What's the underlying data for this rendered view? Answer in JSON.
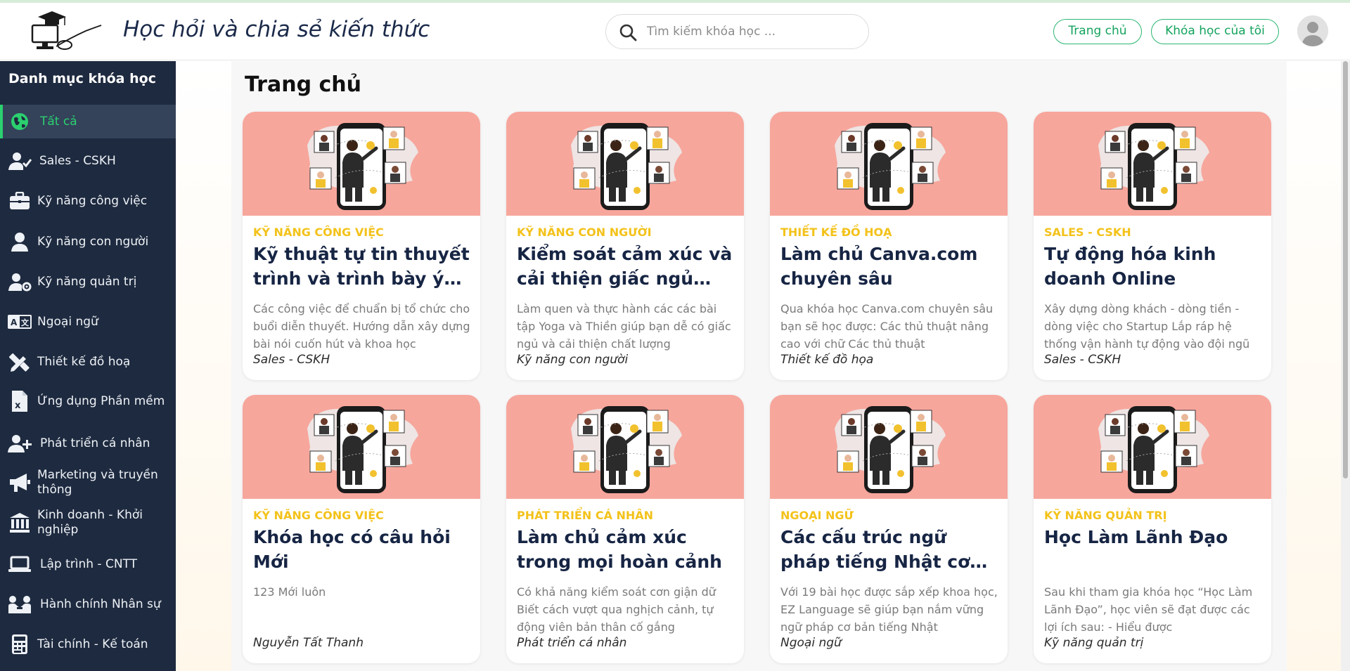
{
  "header": {
    "site_title": "Học hỏi và chia sẻ kiến thức",
    "search_placeholder": "Tìm kiếm khóa học ...",
    "nav_home": "Trang chủ",
    "nav_my_courses": "Khóa học của tôi"
  },
  "sidebar": {
    "title": "Danh mục khóa học",
    "items": [
      {
        "label": "Tất cả",
        "icon": "globe-icon",
        "active": true
      },
      {
        "label": "Sales - CSKH",
        "icon": "user-check-icon"
      },
      {
        "label": "Kỹ năng công việc",
        "icon": "briefcase-icon"
      },
      {
        "label": "Kỹ năng con người",
        "icon": "user-icon"
      },
      {
        "label": "Kỹ năng quản trị",
        "icon": "user-gear-icon"
      },
      {
        "label": "Ngoại ngữ",
        "icon": "language-icon"
      },
      {
        "label": "Thiết kế đồ hoạ",
        "icon": "design-tools-icon"
      },
      {
        "label": "Ứng dụng Phần mềm",
        "icon": "excel-file-icon"
      },
      {
        "label": "Phát triển cá nhân",
        "icon": "user-plus-icon"
      },
      {
        "label": "Marketing và truyền thông",
        "icon": "megaphone-icon"
      },
      {
        "label": "Kinh doanh - Khởi nghiệp",
        "icon": "bank-icon"
      },
      {
        "label": "Lập trình - CNTT",
        "icon": "laptop-icon"
      },
      {
        "label": "Hành chính Nhân sự",
        "icon": "people-icon"
      },
      {
        "label": "Tài chính - Kế toán",
        "icon": "calculator-icon"
      }
    ]
  },
  "main": {
    "page_title": "Trang chủ",
    "courses": [
      {
        "category": "KỸ NĂNG CÔNG VIỆC",
        "title": "Kỹ thuật tự tin thuyết trình và trình bày ý tưởng",
        "description": "Các công việc để chuẩn bị tổ chức cho buổi diễn thuyết. Hướng dẫn xây dựng bài nói cuốn hút và khoa học",
        "tag": "Sales - CSKH"
      },
      {
        "category": "KỸ NĂNG CON NGƯỜI",
        "title": "Kiểm soát cảm xúc và cải thiện giấc ngủ ứng dụng",
        "description": "Làm quen và thực hành các các bài tập Yoga và Thiền giúp bạn dễ có giấc ngủ và cải thiện chất lượng",
        "tag": "Kỹ năng con người"
      },
      {
        "category": "THIẾT KẾ ĐỒ HOẠ",
        "title": "Làm chủ Canva.com chuyên sâu",
        "description": "Qua khóa học Canva.com chuyên sâu bạn sẽ học được: Các thủ thuật nâng cao với chữ Các thủ thuật",
        "tag": "Thiết kế đồ họa"
      },
      {
        "category": "SALES - CSKH",
        "title": "Tự động hóa kinh doanh Online",
        "description": "Xây dựng dòng khách - dòng tiền - dòng việc cho Startup Lắp ráp hệ thống vận hành tự động vào đội ngũ",
        "tag": "Sales - CSKH"
      },
      {
        "category": "KỸ NĂNG CÔNG VIỆC",
        "title": "Khóa học có câu hỏi Mới",
        "description": "123 Mới luôn",
        "tag": "Nguyễn Tất Thanh"
      },
      {
        "category": "PHÁT TRIỂN CÁ NHÂN",
        "title": "Làm chủ cảm xúc trong mọi hoàn cảnh",
        "description": "Có khả năng kiểm soát cơn giận dữ Biết cách vượt qua nghịch cảnh, tự động viên bản thân cố gắng",
        "tag": "Phát triển cá nhân"
      },
      {
        "category": "NGOẠI NGỮ",
        "title": "Các cấu trúc ngữ pháp tiếng Nhật cơ bản",
        "description": "Với 19 bài học được sắp xếp khoa học, EZ Language sẽ giúp bạn nắm vững ngữ pháp cơ bản tiếng Nhật",
        "tag": "Ngoại ngữ"
      },
      {
        "category": "KỸ NĂNG QUẢN TRỊ",
        "title": "Học Làm Lãnh Đạo",
        "description": "Sau khi tham gia khóa học “Học Làm Lãnh Đạo”, học viên sẽ đạt được các lợi ích sau: - Hiểu được",
        "tag": "Kỹ năng quản trị"
      }
    ]
  }
}
